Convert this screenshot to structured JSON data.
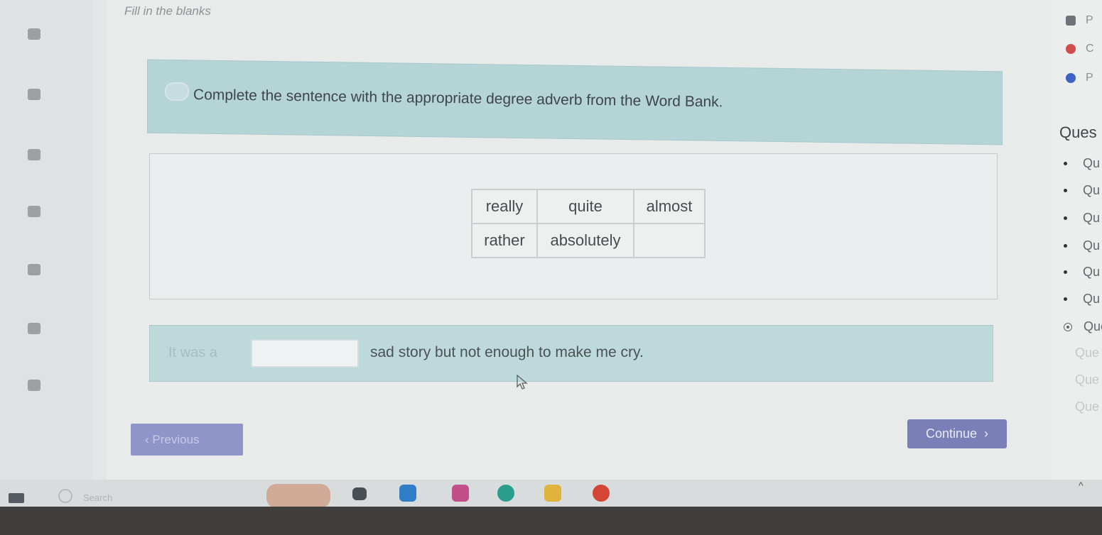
{
  "header": {
    "title": "Fill in the blanks"
  },
  "instruction": {
    "text": "Complete the sentence with the appropriate degree adverb from the Word Bank."
  },
  "word_bank": {
    "rows": [
      [
        "really",
        "quite",
        "almost"
      ],
      [
        "rather",
        "absolutely",
        ""
      ]
    ]
  },
  "sentence": {
    "before": "It was a",
    "blank_value": "",
    "after": "sad story but not enough to make me cry."
  },
  "nav": {
    "previous_label": "Previous",
    "continue_label": "Continue"
  },
  "right_panel": {
    "top_items": [
      {
        "label": "P",
        "icon": "pause-icon",
        "color": "#6d7378"
      },
      {
        "label": "C",
        "icon": "close-circle-icon",
        "color": "#d24b4b"
      },
      {
        "label": "P",
        "icon": "info-icon",
        "color": "#3f63c4"
      }
    ],
    "questions_heading": "Ques",
    "questions": [
      {
        "label": "Qu",
        "state": "done"
      },
      {
        "label": "Qu",
        "state": "done"
      },
      {
        "label": "Qu",
        "state": "done"
      },
      {
        "label": "Qu",
        "state": "done"
      },
      {
        "label": "Qu",
        "state": "done"
      },
      {
        "label": "Qu",
        "state": "done"
      },
      {
        "label": "Que",
        "state": "current"
      },
      {
        "label": "Que",
        "state": "pending"
      },
      {
        "label": "Que",
        "state": "pending"
      },
      {
        "label": "Que",
        "state": "pending"
      }
    ]
  },
  "sidebar": {
    "items": [
      {
        "icon": "assignments-icon"
      },
      {
        "icon": "students-icon"
      },
      {
        "icon": "instructors-icon"
      },
      {
        "icon": "settings-icon"
      },
      {
        "icon": "grades-icon"
      },
      {
        "icon": "goals-icon"
      },
      {
        "icon": "messages-icon"
      }
    ]
  },
  "taskbar": {
    "search_label": "Search",
    "icons": [
      {
        "name": "task-view-icon",
        "color": "#4a4f55"
      },
      {
        "name": "edge-icon",
        "color": "#2f7ec7"
      },
      {
        "name": "copilot-icon",
        "color": "#c24f8a"
      },
      {
        "name": "edge-browser-icon",
        "color": "#2a9d8f"
      },
      {
        "name": "file-explorer-icon",
        "color": "#e0b43c"
      },
      {
        "name": "chrome-icon",
        "color": "#d44535"
      }
    ]
  }
}
